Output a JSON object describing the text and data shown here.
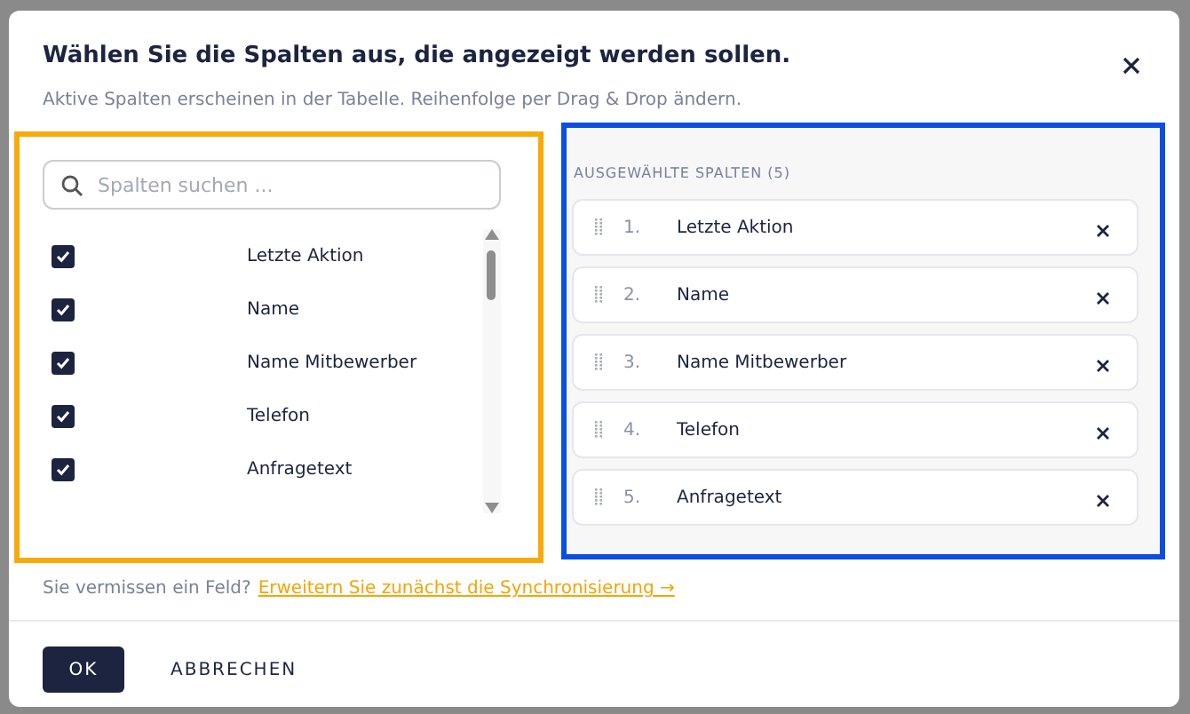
{
  "dialog": {
    "title": "Wählen Sie die Spalten aus, die angezeigt werden sollen.",
    "subtitle": "Aktive Spalten erscheinen in der Tabelle. Reihenfolge per Drag & Drop ändern."
  },
  "available": {
    "search": {
      "placeholder": "Spalten suchen ..."
    },
    "items": [
      {
        "label": "Letzte Aktion",
        "checked": true
      },
      {
        "label": "Name",
        "checked": true
      },
      {
        "label": "Name Mitbewerber",
        "checked": true
      },
      {
        "label": "Telefon",
        "checked": true
      },
      {
        "label": "Anfragetext",
        "checked": true
      }
    ]
  },
  "selected": {
    "heading": "AUSGEWÄHLTE SPALTEN (5)",
    "items": [
      {
        "number": "1.",
        "label": "Letzte Aktion"
      },
      {
        "number": "2.",
        "label": "Name"
      },
      {
        "number": "3.",
        "label": "Name Mitbewerber"
      },
      {
        "number": "4.",
        "label": "Telefon"
      },
      {
        "number": "5.",
        "label": "Anfragetext"
      }
    ]
  },
  "hint": {
    "text": "Sie vermissen ein Feld?",
    "link": "Erweitern Sie zunächst die Synchronisierung →"
  },
  "buttons": {
    "ok": "OK",
    "cancel": "ABBRECHEN"
  }
}
